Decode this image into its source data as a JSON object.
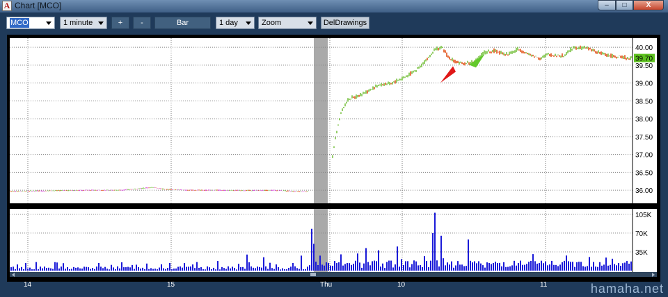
{
  "window": {
    "title": "Chart [MCO]",
    "app_icon": "A",
    "controls": {
      "minimize": "–",
      "maximize": "□",
      "close": "X"
    }
  },
  "toolbar": {
    "symbol": "MCO",
    "interval": "1 minute",
    "zoom_in": "+",
    "zoom_out": "-",
    "chart_type": "Bar",
    "period": "1 day",
    "mode": "Zoom",
    "del_drawings": "DelDrawings"
  },
  "colors": {
    "up_bar": "#7ac142",
    "down_bar": "#e2541b",
    "flat_bar": "#d63ad6",
    "volume": "#1a1ad8",
    "grid": "#808080",
    "session_gap": "#a9a9a9",
    "last_price_tag": "#5ec21f",
    "up_arrow": "#62c92a",
    "down_arrow": "#e01717"
  },
  "chart_data": {
    "type": "bar",
    "symbol": "MCO",
    "interval": "1 minute",
    "last_price": "39.70",
    "price_axis": {
      "range": [
        35.75,
        40.1
      ],
      "ticks": [
        "40.00",
        "39.50",
        "39.00",
        "38.50",
        "38.00",
        "37.50",
        "37.00",
        "36.50",
        "36.00"
      ]
    },
    "volume_axis": {
      "range": [
        0,
        110000
      ],
      "ticks": [
        "105K",
        "70K",
        "35K"
      ]
    },
    "x_ticks": [
      "14",
      "15",
      "Thu",
      "10",
      "11"
    ],
    "annotations": [
      {
        "type": "down-arrow",
        "price": 39.55
      },
      {
        "type": "up-arrow",
        "price": 39.55
      }
    ],
    "price_series": [
      {
        "t": 0,
        "p": 35.97
      },
      {
        "t": 40,
        "p": 35.98
      },
      {
        "t": 80,
        "p": 35.99
      },
      {
        "t": 120,
        "p": 36.0
      },
      {
        "t": 160,
        "p": 36.0
      },
      {
        "t": 190,
        "p": 36.05
      },
      {
        "t": 205,
        "p": 36.08
      },
      {
        "t": 225,
        "p": 36.03
      },
      {
        "t": 260,
        "p": 36.0
      },
      {
        "t": 300,
        "p": 36.0
      },
      {
        "t": 340,
        "p": 35.99
      },
      {
        "t": 380,
        "p": 36.0
      },
      {
        "t": 420,
        "p": 35.96
      },
      {
        "t": 432,
        "p": 35.97
      },
      {
        "t": 466,
        "p": 36.85
      },
      {
        "t": 470,
        "p": 37.4
      },
      {
        "t": 475,
        "p": 37.85
      },
      {
        "t": 480,
        "p": 38.25
      },
      {
        "t": 490,
        "p": 38.55
      },
      {
        "t": 505,
        "p": 38.65
      },
      {
        "t": 520,
        "p": 38.8
      },
      {
        "t": 535,
        "p": 38.95
      },
      {
        "t": 550,
        "p": 38.98
      },
      {
        "t": 570,
        "p": 39.15
      },
      {
        "t": 590,
        "p": 39.4
      },
      {
        "t": 605,
        "p": 39.7
      },
      {
        "t": 615,
        "p": 39.95
      },
      {
        "t": 625,
        "p": 39.98
      },
      {
        "t": 635,
        "p": 39.7
      },
      {
        "t": 650,
        "p": 39.55
      },
      {
        "t": 660,
        "p": 39.55
      },
      {
        "t": 672,
        "p": 39.6
      },
      {
        "t": 685,
        "p": 39.85
      },
      {
        "t": 700,
        "p": 39.9
      },
      {
        "t": 720,
        "p": 39.8
      },
      {
        "t": 735,
        "p": 39.95
      },
      {
        "t": 750,
        "p": 39.8
      },
      {
        "t": 765,
        "p": 39.7
      },
      {
        "t": 780,
        "p": 39.8
      },
      {
        "t": 800,
        "p": 39.75
      },
      {
        "t": 815,
        "p": 40.0
      },
      {
        "t": 835,
        "p": 39.98
      },
      {
        "t": 850,
        "p": 39.85
      },
      {
        "t": 870,
        "p": 39.75
      },
      {
        "t": 885,
        "p": 39.72
      },
      {
        "t": 895,
        "p": 39.7
      }
    ],
    "volume_spikes": [
      {
        "t": 435,
        "v": 78000
      },
      {
        "t": 438,
        "v": 50000
      },
      {
        "t": 445,
        "v": 28000
      },
      {
        "t": 468,
        "v": 18000
      },
      {
        "t": 500,
        "v": 32000
      },
      {
        "t": 512,
        "v": 42000
      },
      {
        "t": 530,
        "v": 38000
      },
      {
        "t": 558,
        "v": 45000
      },
      {
        "t": 612,
        "v": 108000
      },
      {
        "t": 608,
        "v": 70000
      },
      {
        "t": 620,
        "v": 65000
      },
      {
        "t": 662,
        "v": 58000
      },
      {
        "t": 342,
        "v": 30000
      },
      {
        "t": 365,
        "v": 25000
      },
      {
        "t": 420,
        "v": 28000
      },
      {
        "t": 35,
        "v": 16000
      },
      {
        "t": 300,
        "v": 18000
      }
    ]
  },
  "watermark": "hamaha.net"
}
